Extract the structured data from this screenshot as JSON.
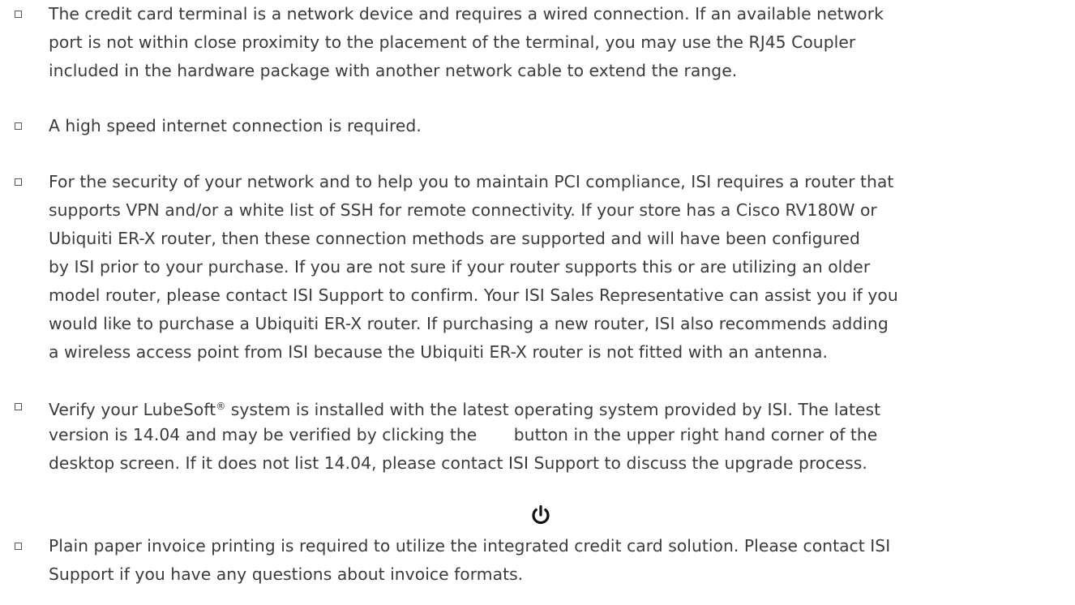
{
  "items": [
    {
      "lines": [
        "The credit card terminal is a network device and requires a wired connection. If an available network",
        "port is not within close proximity to the placement of the terminal, you may use the RJ45 Coupler",
        "included in the hardware package with another network cable to extend the range."
      ]
    },
    {
      "lines": [
        "A high speed internet connection is required."
      ]
    },
    {
      "lines": [
        "For the security of your network and to help you to maintain PCI compliance, ISI requires a router that",
        "supports VPN and/or a white list of SSH for remote connectivity. If your store has a Cisco RV180W or",
        "Ubiquiti ER-X router, then these connection methods are supported and will have been configured",
        "by ISI prior to your purchase. If you are not sure if your router supports this or are utilizing an older",
        "model router, please contact ISI Support to confirm. Your ISI Sales Representative can assist you if you",
        "would like to purchase a Ubiquiti ER-X router. If purchasing a new router, ISI also recommends adding",
        "a wireless access point from ISI because the Ubiquiti ER-X router is not fitted with an antenna."
      ]
    },
    {
      "line1_before": "Verify your LubeSoft",
      "line1_registered": "®",
      "line1_after": " system is installed with the latest operating system provided by ISI. The latest",
      "line2": "version is 14.04 and may be verified by clicking the       button in the upper right hand corner of the",
      "line3": "desktop screen. If it does not list 14.04, please contact ISI Support to discuss the upgrade process."
    },
    {
      "lines": [
        "Plain paper invoice printing is required to utilize the integrated credit card solution. Please contact ISI",
        "Support if you have any questions about invoice formats."
      ]
    }
  ],
  "icons": {
    "power": "power-icon"
  }
}
